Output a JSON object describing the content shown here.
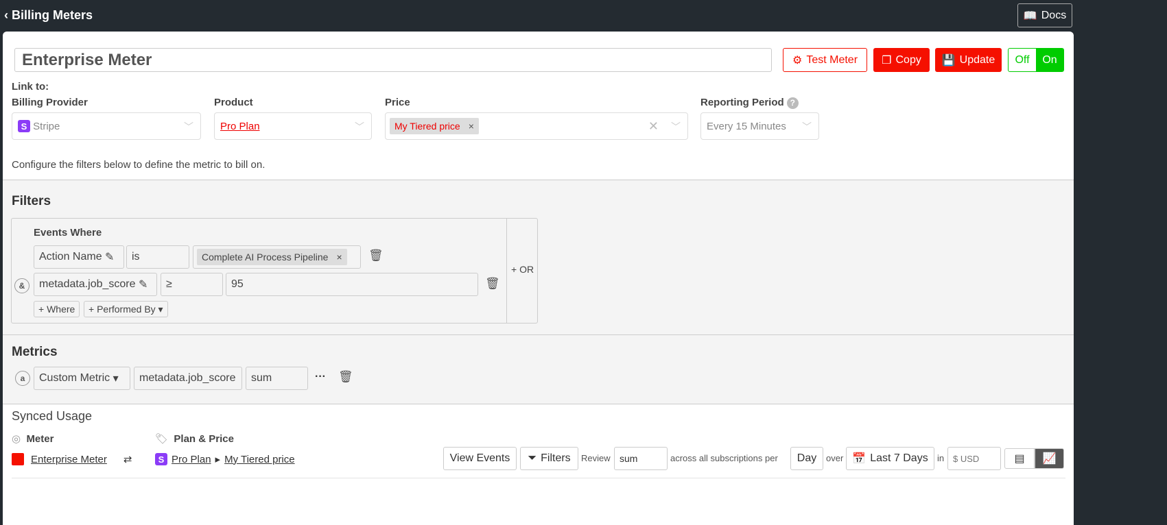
{
  "header": {
    "back_label": "Billing Meters",
    "docs_label": "Docs"
  },
  "meter": {
    "name": "Enterprise Meter",
    "test_label": "Test Meter",
    "copy_label": "Copy",
    "update_label": "Update",
    "toggle_off": "Off",
    "toggle_on": "On"
  },
  "link": {
    "title": "Link to:",
    "provider_label": "Billing Provider",
    "provider_value": "Stripe",
    "product_label": "Product",
    "product_value": "Pro Plan",
    "price_label": "Price",
    "price_chip": "My Tiered price",
    "period_label": "Reporting Period",
    "period_value": "Every 15 Minutes",
    "help": "Configure the filters below to define the metric to bill on."
  },
  "filters": {
    "title": "Filters",
    "events_where": "Events Where",
    "and_label": "&",
    "row1": {
      "field": "Action Name",
      "op": "is",
      "value": "Complete AI Process Pipeline"
    },
    "row2": {
      "field": "metadata.job_score",
      "op": "≥",
      "value": "95"
    },
    "add_where": "+ Where",
    "add_performed": "+ Performed By",
    "or_label": "+ OR"
  },
  "metrics": {
    "title": "Metrics",
    "letter": "a",
    "type": "Custom Metric",
    "field": "metadata.job_score",
    "agg": "sum",
    "more": "···"
  },
  "synced": {
    "title": "Synced Usage",
    "meter_label": "Meter",
    "meter_value": "Enterprise Meter",
    "plan_label": "Plan & Price",
    "plan_value": "Pro Plan",
    "arrow": "▸",
    "price_value": "My Tiered price",
    "view_events": "View Events",
    "filters": "Filters",
    "review": "Review",
    "review_value": "sum",
    "across": "across all subscriptions per",
    "per_value": "Day",
    "over": "over",
    "range": "Last 7 Days",
    "in": "in",
    "currency_placeholder": "$ USD"
  }
}
